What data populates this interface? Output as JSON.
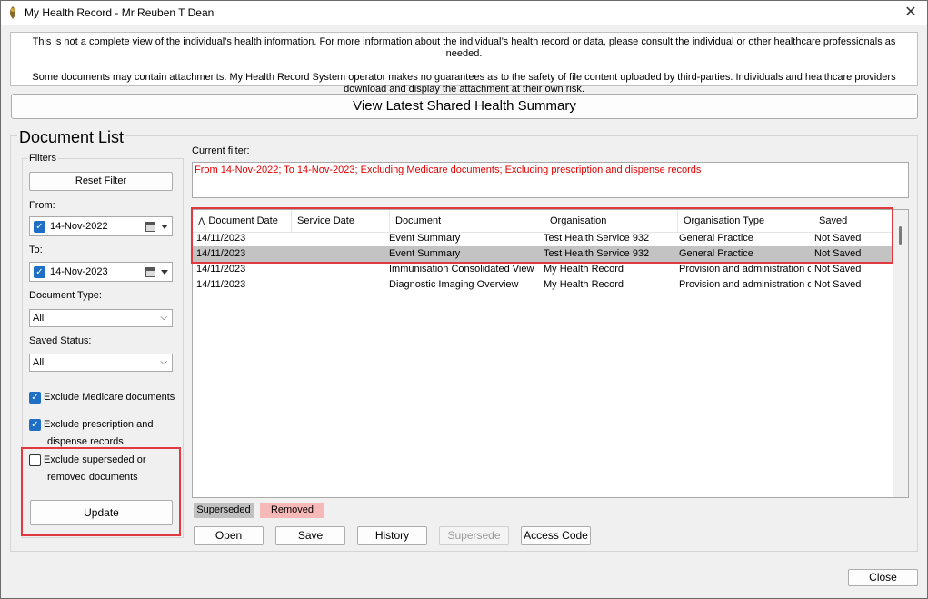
{
  "window": {
    "title": "My Health Record - Mr Reuben T Dean"
  },
  "disclaimer": {
    "line1": "This is not a complete view of the individual’s health information. For more information about the individual’s health record or data, please consult the individual or other healthcare professionals as needed.",
    "line2": "Some documents may contain attachments. My Health Record System operator makes no guarantees as to the safety of file content uploaded by third-parties. Individuals and healthcare providers download and display the attachment at their own risk."
  },
  "summary_button": "View Latest Shared Health Summary",
  "document_list": {
    "title": "Document List",
    "filters": {
      "title": "Filters",
      "reset_label": "Reset Filter",
      "from_label": "From:",
      "from_value": "14-Nov-2022",
      "to_label": "To:",
      "to_value": "14-Nov-2023",
      "document_type_label": "Document Type:",
      "document_type_value": "All",
      "saved_status_label": "Saved Status:",
      "saved_status_value": "All",
      "exclude_medicare_label": "Exclude Medicare documents",
      "exclude_medicare_checked": true,
      "exclude_prescription_label_1": "Exclude prescription and",
      "exclude_prescription_label_2": "dispense records",
      "exclude_prescription_checked": true,
      "exclude_superseded_label_1": "Exclude superseded or",
      "exclude_superseded_label_2": "removed documents",
      "exclude_superseded_checked": false,
      "update_label": "Update"
    },
    "current_filter_label": "Current filter:",
    "current_filter_text": "From 14-Nov-2022; To 14-Nov-2023; Excluding Medicare documents; Excluding prescription and dispense records",
    "columns": [
      "Document Date",
      "Service Date",
      "Document",
      "Organisation",
      "Organisation Type",
      "Saved"
    ],
    "rows": [
      {
        "document_date": "14/11/2023",
        "service_date": "",
        "document": "Event Summary",
        "organisation": "Test Health Service 932",
        "organisation_type": "General Practice",
        "saved": "Not Saved"
      },
      {
        "document_date": "14/11/2023",
        "service_date": "",
        "document": "Event Summary",
        "organisation": "Test Health Service 932",
        "organisation_type": "General Practice",
        "saved": "Not Saved"
      },
      {
        "document_date": "14/11/2023",
        "service_date": "",
        "document": "Immunisation Consolidated View",
        "organisation": "My Health Record",
        "organisation_type": "Provision and administration of public",
        "saved": "Not Saved"
      },
      {
        "document_date": "14/11/2023",
        "service_date": "",
        "document": "Diagnostic Imaging Overview",
        "organisation": "My Health Record",
        "organisation_type": "Provision and administration of public",
        "saved": "Not Saved"
      }
    ],
    "legend": {
      "superseded": "Superseded",
      "removed": "Removed"
    },
    "actions": {
      "open": "Open",
      "save": "Save",
      "history": "History",
      "supersede": "Supersede",
      "access_code": "Access Code"
    }
  },
  "close_label": "Close",
  "colors": {
    "selected_row": "#c3c3c3",
    "superseded": "#c0c0c0",
    "removed": "#f7b8b8",
    "filter_text": "#e00000",
    "highlight": "#e0393f"
  }
}
